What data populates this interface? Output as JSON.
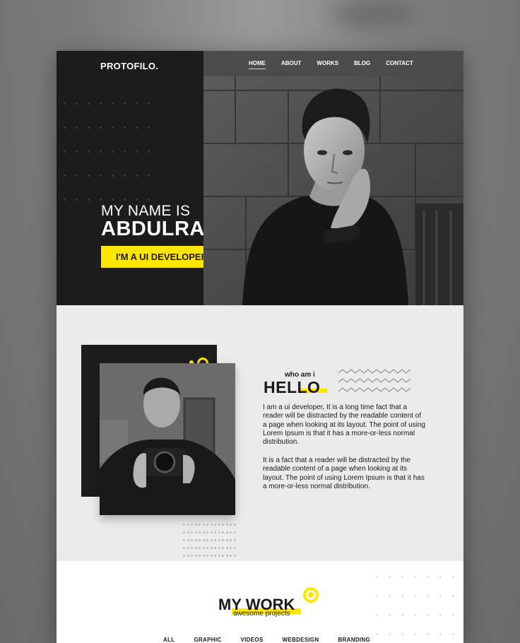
{
  "site": {
    "logo": "PROTOFILO."
  },
  "nav": {
    "items": [
      {
        "label": "HOME",
        "active": true
      },
      {
        "label": "ABOUT"
      },
      {
        "label": "WORKS"
      },
      {
        "label": "BLOG"
      },
      {
        "label": "CONTACT"
      }
    ]
  },
  "hero": {
    "line1": "MY NAME IS",
    "line2": "ABDULRAHMAN",
    "cta": "I'M A UI DEVELOPER"
  },
  "about": {
    "kicker": "who am i",
    "heading": "HELLO",
    "para1": "I am a ui developer, It is a long time fact that a reader will be distracted by the readable content of a page when looking at its layout. The point of using Lorem Ipsum is that it has a more-or-less normal distribution.",
    "para2": "It is a fact that a reader will be distracted by the readable content of a page when looking at its layout. The point of using Lorem Ipsum is that it has a more-or-less normal distribution."
  },
  "work": {
    "title": "MY WORK",
    "subtitle": "awesome projects",
    "filters": [
      "ALL",
      "GRAPHIC",
      "VIDEOS",
      "WEBDESIGN",
      "BRANDING"
    ]
  },
  "colors": {
    "accent": "#ffe600",
    "dark": "#1c1c1c",
    "light_bg": "#ebebeb"
  }
}
